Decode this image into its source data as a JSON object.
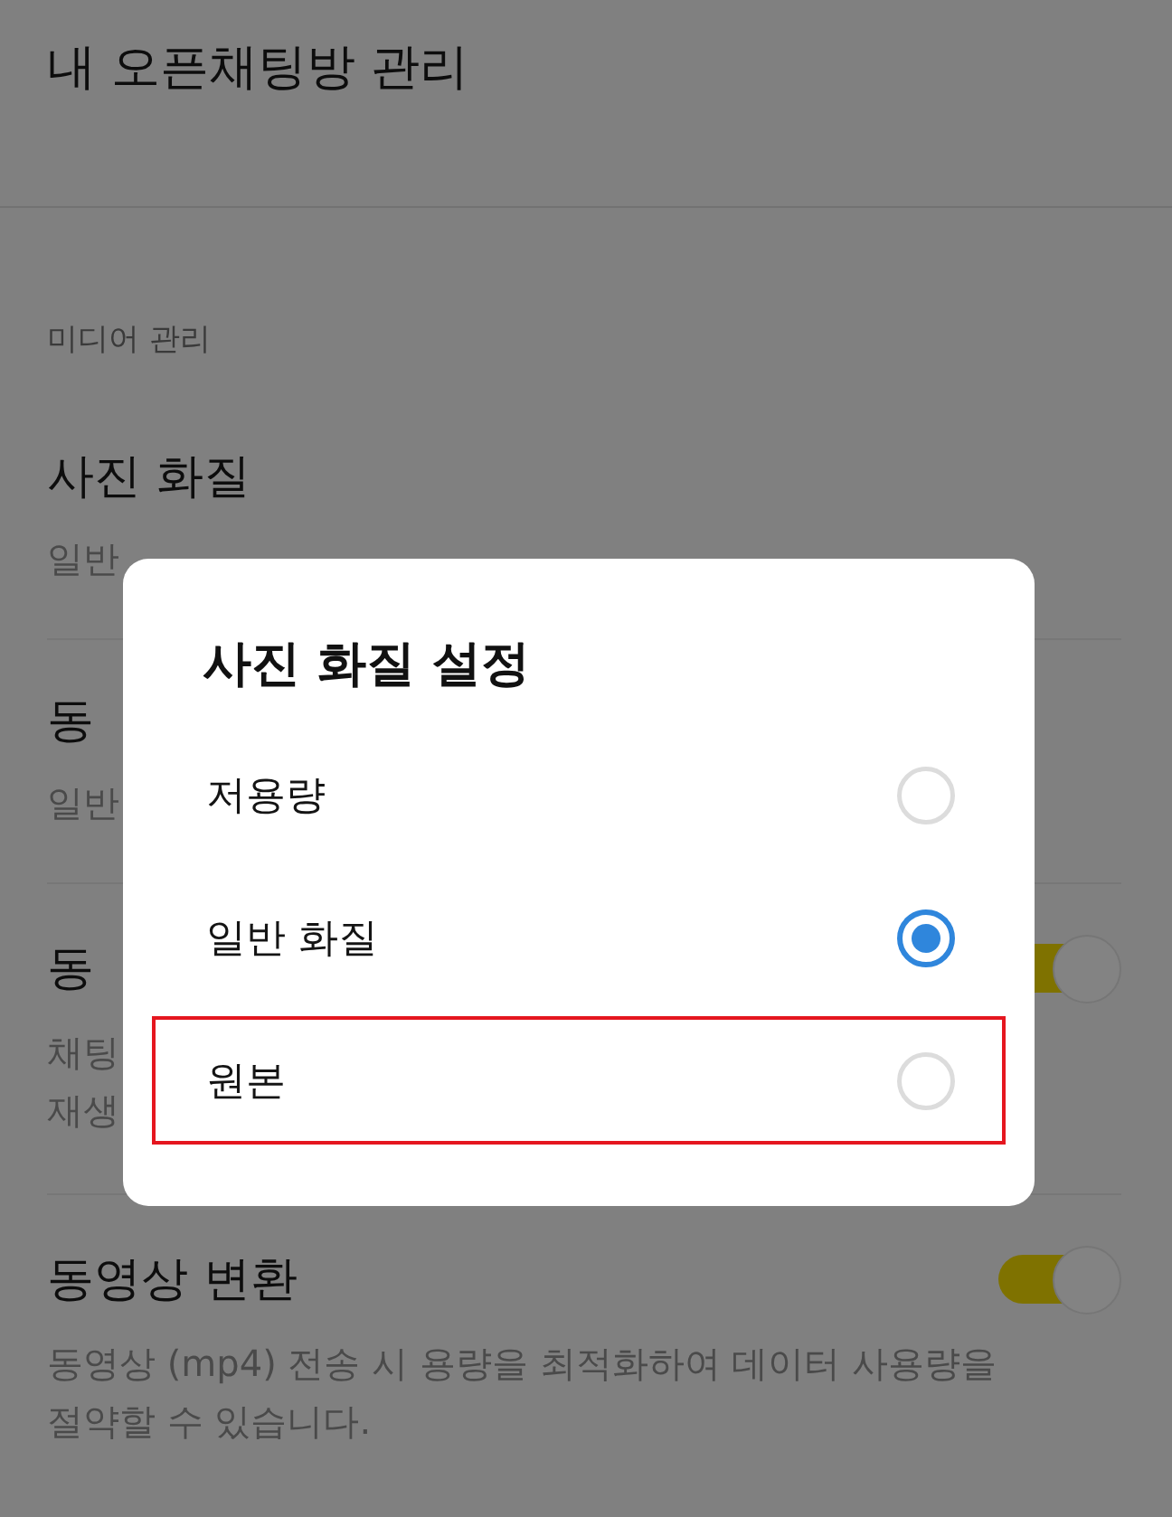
{
  "header": {
    "title": "내 오픈채팅방 관리"
  },
  "section": {
    "label": "미디어 관리"
  },
  "settings": [
    {
      "kind": "choice",
      "title": "사진 화질",
      "subtitle": "일반"
    },
    {
      "kind": "choice",
      "title": "동",
      "subtitle": "일반"
    },
    {
      "kind": "toggle",
      "title": "동",
      "on": true,
      "description": "채팅\n재생"
    },
    {
      "kind": "toggle",
      "title": "동영상 변환",
      "on": true,
      "description": "동영상 (mp4) 전송 시 용량을 최적화하여 데이터 사용량을 절약할 수 있습니다."
    }
  ],
  "dialog": {
    "title": "사진 화질 설정",
    "options": [
      {
        "label": "저용량",
        "selected": false,
        "highlighted": false
      },
      {
        "label": "일반 화질",
        "selected": true,
        "highlighted": false
      },
      {
        "label": "원본",
        "selected": false,
        "highlighted": true
      }
    ]
  }
}
